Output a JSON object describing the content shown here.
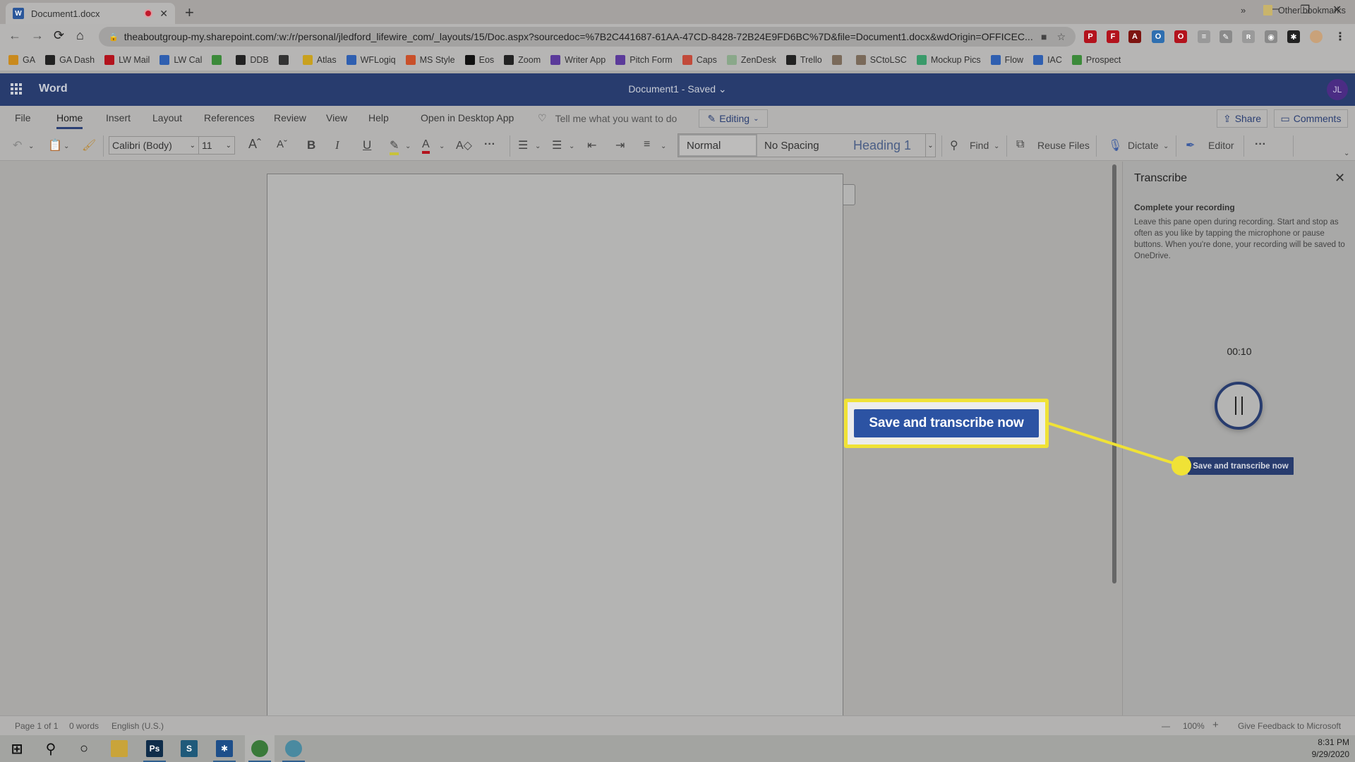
{
  "browser": {
    "tab": {
      "title": "Document1.docx",
      "favicon": "word-doc-icon",
      "recording_indicator": "record-icon"
    },
    "new_tab": "+",
    "window_controls": {
      "minimize": "—",
      "restore": "❐",
      "close": "✕"
    },
    "nav": {
      "back": "←",
      "forward": "→",
      "reload": "⟳",
      "home": "⌂"
    },
    "url": "theaboutgroup-my.sharepoint.com/:w:/r/personal/jledford_lifewire_com/_layouts/15/Doc.aspx?sourcedoc=%7B2C441687-61AA-47CD-8428-72B24E9FD6BC%7D&file=Document1.docx&wdOrigin=OFFICEC...",
    "extensions": [
      {
        "name": "pinterest-icon",
        "glyph": "P",
        "color": "#b3131d"
      },
      {
        "name": "flipboard-icon",
        "glyph": "F",
        "color": "#b3131d"
      },
      {
        "name": "acrobat-icon",
        "glyph": "A",
        "color": "#7d1410"
      },
      {
        "name": "extension-badge-icon",
        "glyph": "O",
        "color": "#2f6fb0"
      },
      {
        "name": "opera-icon",
        "glyph": "O",
        "color": "#b3131d"
      },
      {
        "name": "doc-extension-icon",
        "glyph": "≡",
        "color": "#999999"
      },
      {
        "name": "pen-extension-icon",
        "glyph": "✎",
        "color": "#8a8a8a"
      },
      {
        "name": "text-extension-icon",
        "glyph": "ʀ",
        "color": "#9a9a9a"
      },
      {
        "name": "camera-extension-icon",
        "glyph": "◉",
        "color": "#8a8a8a"
      },
      {
        "name": "puzzle-icon",
        "glyph": "✱",
        "color": "#222222"
      }
    ],
    "bookmarks": [
      {
        "label": "GA",
        "icon": "analytics-icon",
        "color": "#c98a1e"
      },
      {
        "label": "GA Dash",
        "icon": "globe-icon",
        "color": "#222222"
      },
      {
        "label": "LW Mail",
        "icon": "gmail-icon",
        "color": "#b3131d"
      },
      {
        "label": "LW Cal",
        "icon": "calendar-icon",
        "color": "#2f5fb0"
      },
      {
        "label": "",
        "icon": "drive-icon",
        "color": "#3c8a3a"
      },
      {
        "label": "DDB",
        "icon": "globe-icon",
        "color": "#222222"
      },
      {
        "label": "",
        "icon": "g-icon",
        "color": "#333333"
      },
      {
        "label": "Atlas",
        "icon": "atlas-icon",
        "color": "#c9a11e"
      },
      {
        "label": "WFLogiq",
        "icon": "wflogiq-icon",
        "color": "#2f5fb0"
      },
      {
        "label": "MS Style",
        "icon": "microsoft-icon",
        "color": "#c9502a"
      },
      {
        "label": "Eos",
        "icon": "eos-icon",
        "color": "#111111"
      },
      {
        "label": "Zoom",
        "icon": "globe-icon",
        "color": "#222222"
      },
      {
        "label": "Writer App",
        "icon": "form-icon",
        "color": "#5b3a9a"
      },
      {
        "label": "Pitch Form",
        "icon": "form-icon",
        "color": "#5b3a9a"
      },
      {
        "label": "Caps",
        "icon": "caps-icon",
        "color": "#c24a3a"
      },
      {
        "label": "ZenDesk",
        "icon": "zendesk-icon",
        "color": "#8aa88a"
      },
      {
        "label": "Trello",
        "icon": "globe-icon",
        "color": "#222222"
      },
      {
        "label": "",
        "icon": "person-icon",
        "color": "#7a6a5a"
      },
      {
        "label": "SCtoLSC",
        "icon": "person-icon",
        "color": "#7a6a5a"
      },
      {
        "label": "Mockup Pics",
        "icon": "mockup-icon",
        "color": "#3a9a6a"
      },
      {
        "label": "Flow",
        "icon": "flow-icon",
        "color": "#2f5fb0"
      },
      {
        "label": "IAC",
        "icon": "iac-icon",
        "color": "#2f5fb0"
      },
      {
        "label": "Prospect",
        "icon": "prospect-icon",
        "color": "#3c8a3a"
      }
    ],
    "bookmarks_more": "»",
    "other_bookmarks": "Other bookmarks"
  },
  "word": {
    "app_name": "Word",
    "doc_title": "Document1  -  Saved ⌄",
    "avatar_initials": "JL",
    "ribbon_tabs": [
      "File",
      "Home",
      "Insert",
      "Layout",
      "References",
      "Review",
      "View",
      "Help",
      "Open in Desktop App"
    ],
    "active_tab": "Home",
    "tell_me": "Tell me what you want to do",
    "editing_label": "Editing",
    "share_label": "Share",
    "comments_label": "Comments",
    "font_name": "Calibri (Body)",
    "font_size": "11",
    "styles": [
      "Normal",
      "No Spacing",
      "Heading 1"
    ],
    "selected_style": "Normal",
    "find_label": "Find",
    "reuse_files_label": "Reuse Files",
    "dictate_label": "Dictate",
    "editor_label": "Editor",
    "more_label": "···"
  },
  "callout": {
    "label": "Save and transcribe now",
    "highlight_color": "#f0e236"
  },
  "transcribe_pane": {
    "title": "Transcribe",
    "close": "✕",
    "subtitle": "Complete your recording",
    "description": "Leave this pane open during recording. Start and stop as often as you like by tapping the microphone or pause buttons. When you're done, your recording will be saved to OneDrive.",
    "timer": "00:10",
    "save_button": "Save and transcribe now"
  },
  "statusbar": {
    "page": "Page 1 of 1",
    "words": "0 words",
    "language": "English (U.S.)",
    "zoom_out": "—",
    "zoom": "100%",
    "zoom_in": "+",
    "feedback": "Give Feedback to Microsoft"
  },
  "taskbar": {
    "time": "8:31 PM",
    "date": "9/29/2020",
    "apps": [
      {
        "name": "start-icon",
        "glyph": "⊞",
        "color": "#111111"
      },
      {
        "name": "search-icon",
        "glyph": "⚲",
        "color": "#111111"
      },
      {
        "name": "cortana-icon",
        "glyph": "○",
        "color": "#111111"
      },
      {
        "name": "file-explorer-icon",
        "glyph": "",
        "color": "#c9a43a"
      },
      {
        "name": "photoshop-icon",
        "glyph": "Ps",
        "color": "#0f2d4a"
      },
      {
        "name": "snagit-icon",
        "glyph": "S",
        "color": "#1f5a7a"
      },
      {
        "name": "slack-icon",
        "glyph": "✱",
        "color": "#1e4f8a"
      },
      {
        "name": "chrome-icon",
        "glyph": "",
        "color": "#3a7a3a"
      },
      {
        "name": "network-globe-icon",
        "glyph": "",
        "color": "#4a8aa0"
      }
    ]
  }
}
